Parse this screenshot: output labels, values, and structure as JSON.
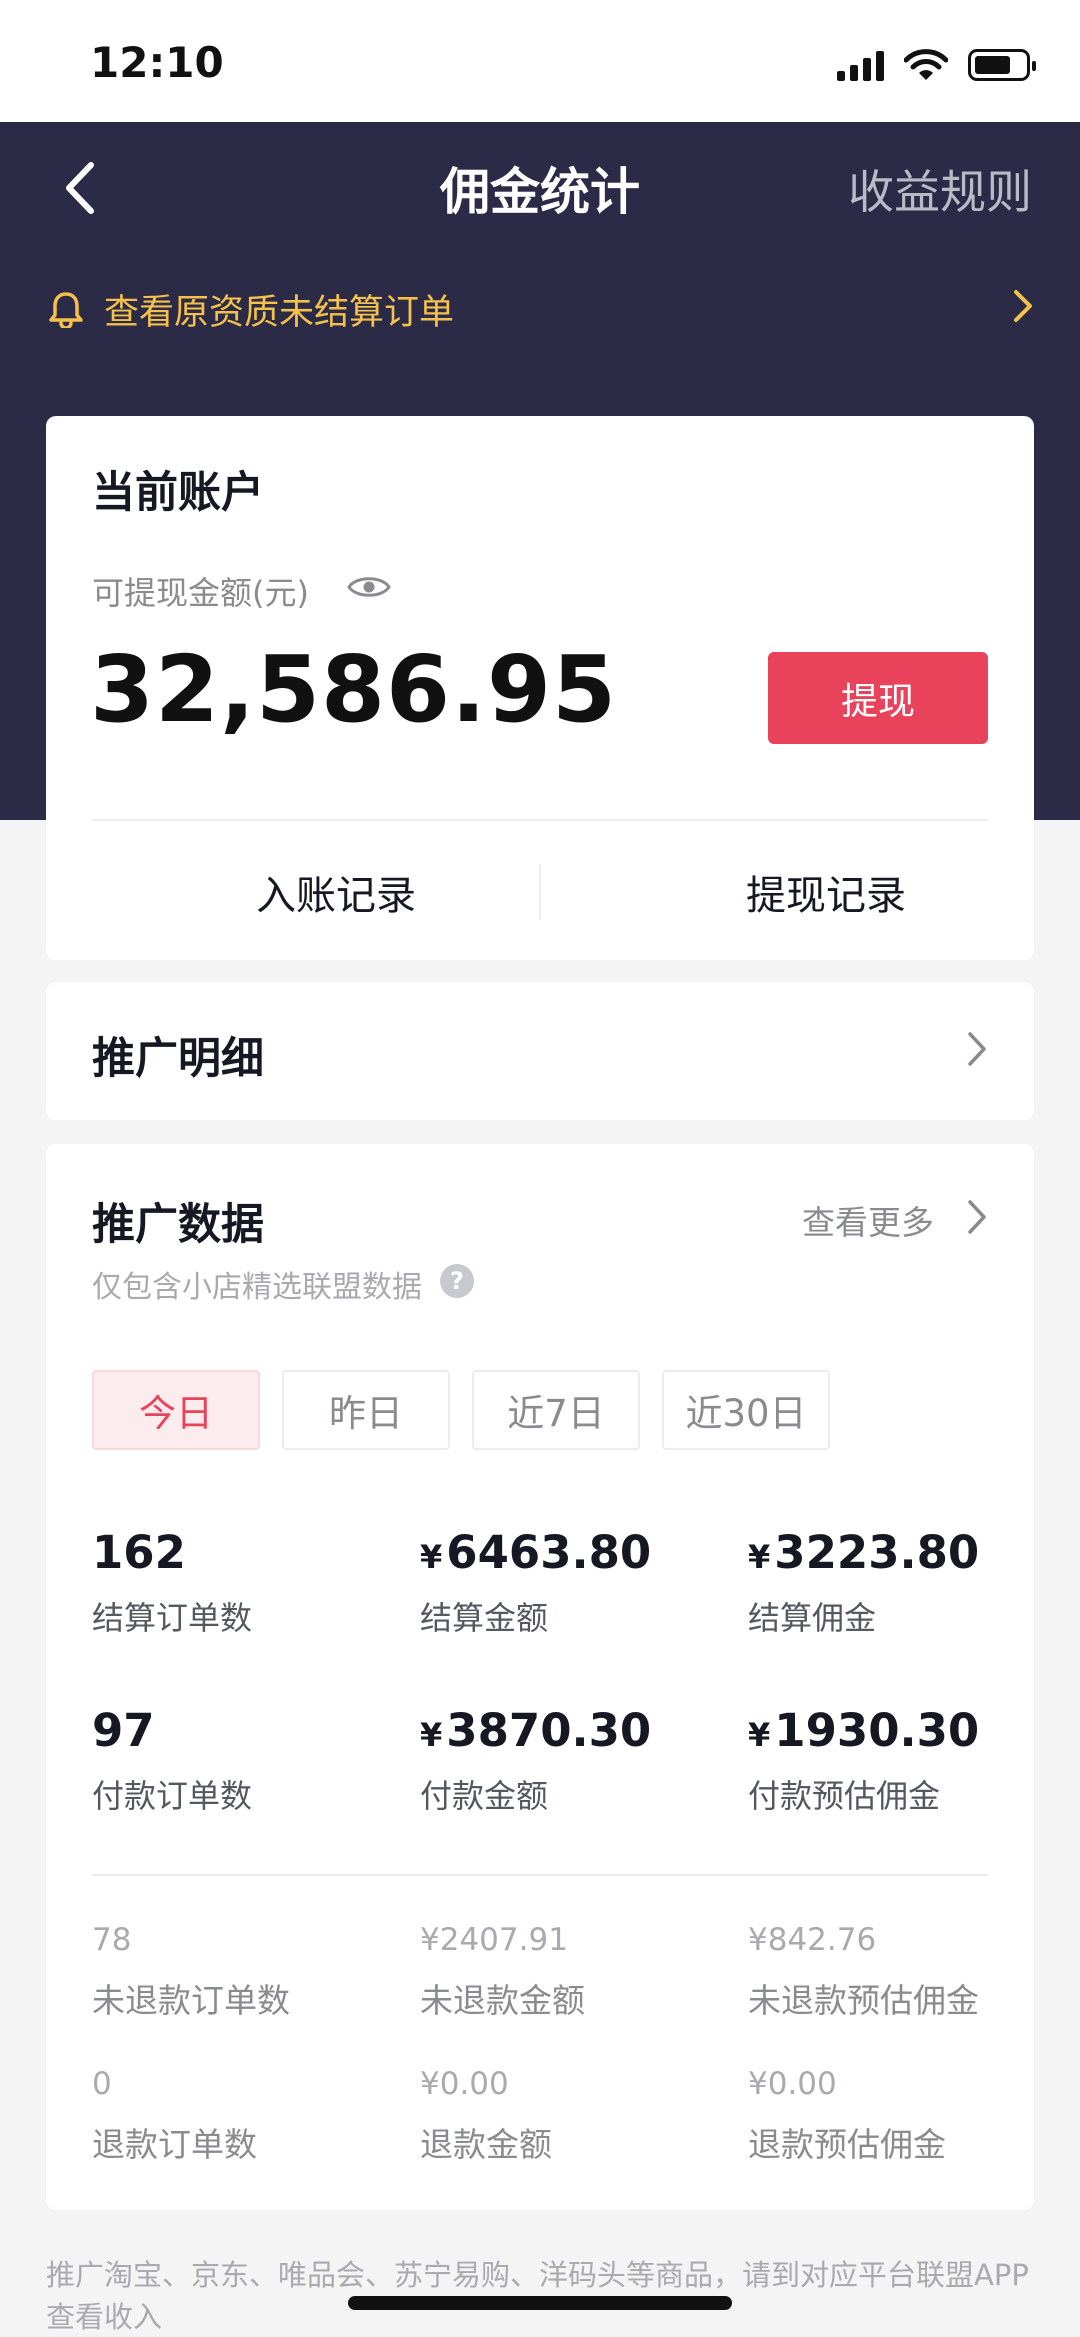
{
  "status": {
    "time": "12:10"
  },
  "nav": {
    "title": "佣金统计",
    "right_label": "收益规则"
  },
  "notice": {
    "text": "查看原资质未结算订单"
  },
  "account": {
    "title": "当前账户",
    "balance_label": "可提现金额(元)",
    "balance": "32,586.95",
    "withdraw_label": "提现",
    "links": [
      "入账记录",
      "提现记录"
    ]
  },
  "detail": {
    "title": "推广明细"
  },
  "data": {
    "title": "推广数据",
    "more": "查看更多",
    "note": "仅包含小店精选联盟数据",
    "tabs": [
      "今日",
      "昨日",
      "近7日",
      "近30日"
    ],
    "active_tab": "今日",
    "currency": "¥",
    "primary_stats": [
      {
        "value": "162",
        "label": "结算订单数"
      },
      {
        "value": "6463.80",
        "label": "结算金额"
      },
      {
        "value": "3223.80",
        "label": "结算佣金"
      },
      {
        "value": "97",
        "label": "付款订单数"
      },
      {
        "value": "3870.30",
        "label": "付款金额"
      },
      {
        "value": "1930.30",
        "label": "付款预估佣金"
      }
    ],
    "secondary_stats": [
      {
        "value": "78",
        "label": "未退款订单数"
      },
      {
        "value": "¥2407.91",
        "label": "未退款金额"
      },
      {
        "value": "¥842.76",
        "label": "未退款预估佣金"
      },
      {
        "value": "0",
        "label": "退款订单数"
      },
      {
        "value": "¥0.00",
        "label": "退款金额"
      },
      {
        "value": "¥0.00",
        "label": "退款预估佣金"
      }
    ]
  },
  "footer": {
    "note": "推广淘宝、京东、唯品会、苏宁易购、洋码头等商品，请到对应平台联盟APP查看收入"
  },
  "colors": {
    "header_bg": "#2b2b48",
    "accent": "#e8435a",
    "notice": "#f5c14b"
  }
}
